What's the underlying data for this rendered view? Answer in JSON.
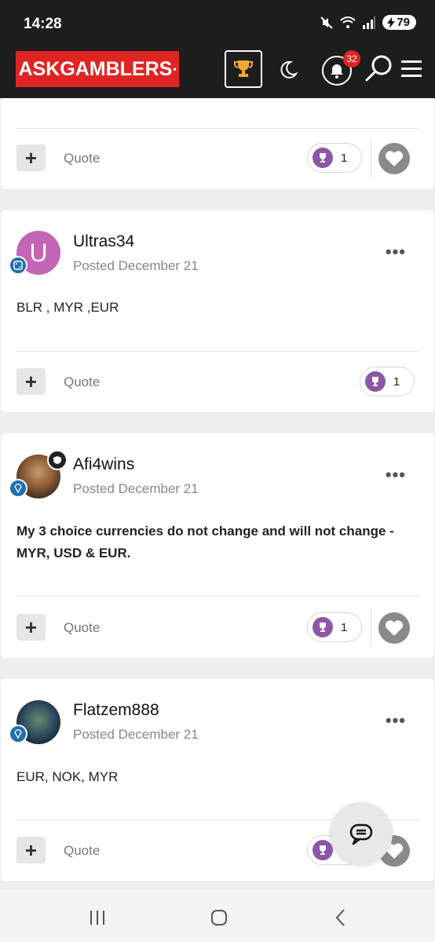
{
  "status_bar": {
    "time": "14:28",
    "battery": "79"
  },
  "header": {
    "logo_text": "ASKGAMBLERS",
    "logo_mark": "•",
    "notification_count": "32",
    "accent_color": "#e02424"
  },
  "posts": [
    {
      "id": "partial",
      "quote_label": "Quote",
      "reaction_count": "1"
    },
    {
      "id": "ultras34",
      "avatar_letter": "U",
      "username": "Ultras34",
      "posted": "Posted December 21",
      "body": "BLR , MYR ,EUR",
      "quote_label": "Quote",
      "reaction_count": "1"
    },
    {
      "id": "afi4wins",
      "username": "Afi4wins",
      "posted": "Posted December 21",
      "body": "My 3 choice currencies do not change and will not change - MYR, USD & EUR.",
      "quote_label": "Quote",
      "reaction_count": "1"
    },
    {
      "id": "flatzem888",
      "username": "Flatzem888",
      "posted": "Posted December 21",
      "body": "EUR, NOK, MYR",
      "quote_label": "Quote",
      "reaction_count": "1"
    }
  ],
  "icons": [
    "trophy-icon",
    "moon-icon",
    "bell-icon",
    "search-icon",
    "menu-icon",
    "plus-icon",
    "heart-icon",
    "chat-icon",
    "more-icon"
  ]
}
